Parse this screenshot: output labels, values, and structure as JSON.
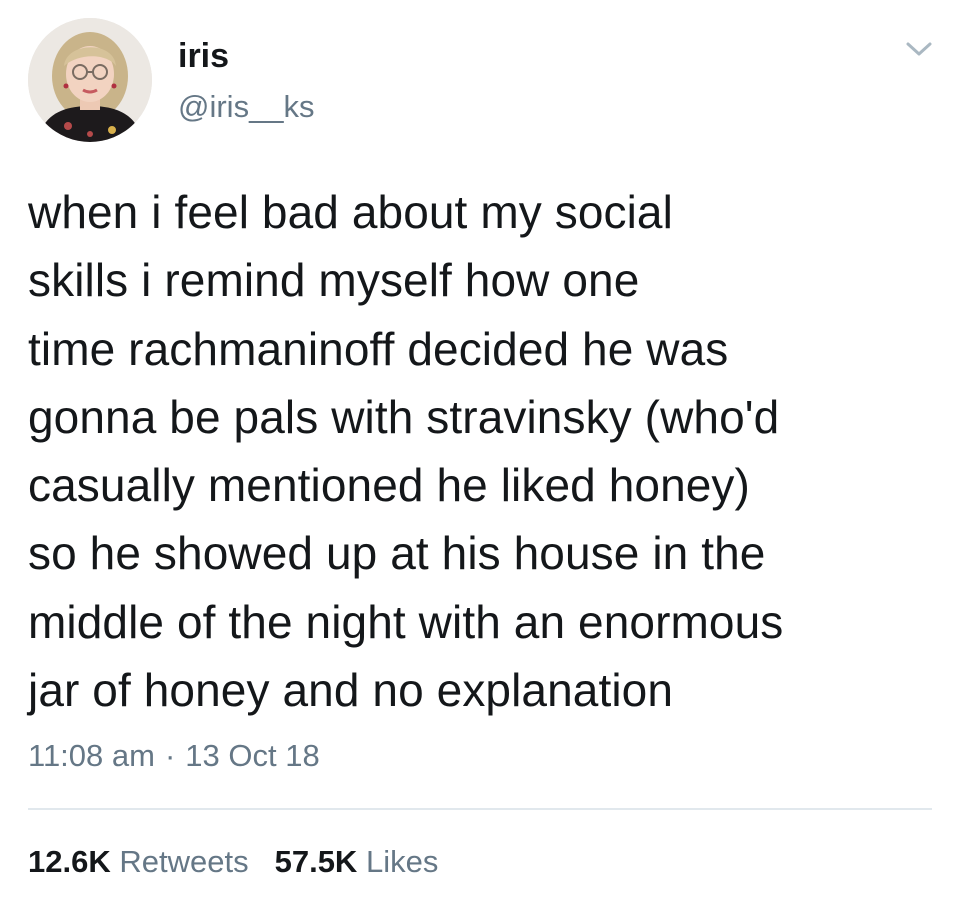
{
  "user": {
    "display_name": "iris",
    "handle": "@iris__ks",
    "avatar_icon": "profile-photo"
  },
  "tweet": {
    "text": "when i feel bad about my social\nskills i remind myself how one\ntime rachmaninoff decided he was\ngonna be pals with stravinsky (who'd\ncasually mentioned he liked honey)\nso he showed up at his house in the\nmiddle of the night with an enormous\njar of honey and no explanation",
    "time": "11:08 am",
    "separator": "·",
    "date": "13 Oct 18"
  },
  "stats": {
    "retweets_count": "12.6K",
    "retweets_label": "Retweets",
    "likes_count": "57.5K",
    "likes_label": "Likes"
  },
  "icons": {
    "menu": "chevron-down-icon"
  },
  "colors": {
    "primary_text": "#14171a",
    "secondary_text": "#657786",
    "divider": "#e1e8ed"
  }
}
